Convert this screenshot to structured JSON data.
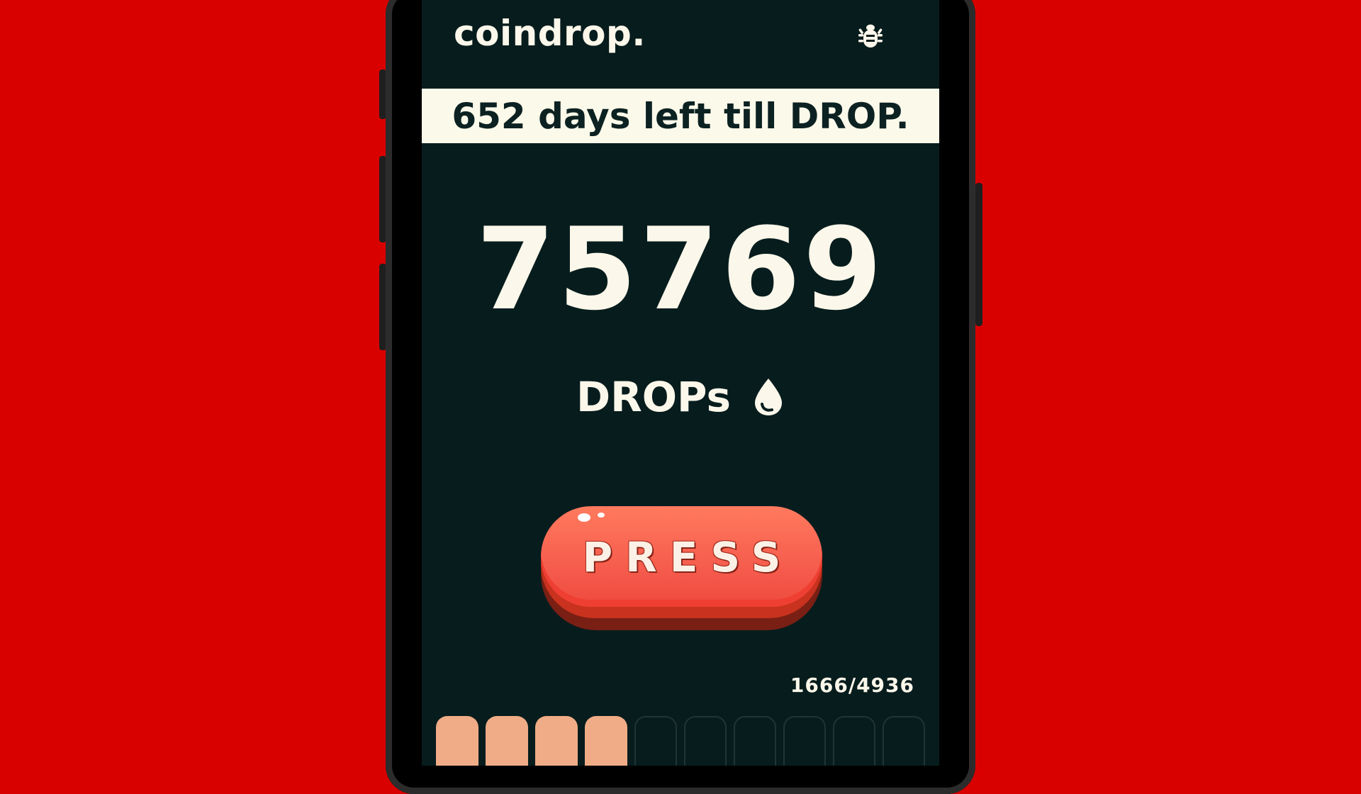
{
  "app": {
    "title": "coindrop.",
    "bug_icon": "bug-icon"
  },
  "banner": {
    "text": "652 days left till DROP."
  },
  "counter": {
    "value": "75769",
    "unit": "DROPs",
    "unit_icon": "drop-icon"
  },
  "press_button": {
    "label": "PRESS"
  },
  "progress": {
    "label": "1666/4936",
    "current": 1666,
    "total": 4936,
    "filled_cells": 4,
    "total_cells": 10
  },
  "colors": {
    "background": "#d90000",
    "screen": "#071c1d",
    "banner": "#fbf9ea",
    "button": "#f4584a",
    "cell_filled": "#f0ac86"
  }
}
